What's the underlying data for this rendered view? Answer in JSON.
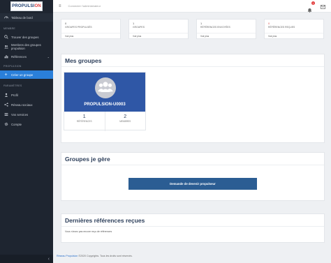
{
  "brand": {
    "logo_main": "PROPULSI",
    "logo_accent": "ON"
  },
  "topbar": {
    "title": "Connecter l'administrateur",
    "notif_count": "1"
  },
  "sidebar": {
    "dashboard": "Tableau de bord",
    "section_membre": "MEMBRE",
    "find_groups": "Trouver des groupes",
    "members_line1": "Membres des groupes",
    "members_line2": "propulsion",
    "references": "Références",
    "section_propulsion": "PROPULSION",
    "create_group": "Créer un groupe",
    "section_parametres": "PARAMÈTRES",
    "profile": "Profil",
    "social": "Réseau sociaux",
    "services": "Vos services",
    "account": "Compte"
  },
  "stats": [
    {
      "value": "0",
      "label": "GROUPES PROPULSÉS",
      "link": "Voir plus"
    },
    {
      "value": "1",
      "label": "GROUPES",
      "link": "Voir plus"
    },
    {
      "value": "1",
      "label": "RÉFÉRENCES ENVOYÉES",
      "link": "Voir plus"
    },
    {
      "value": "0",
      "label": "RÉFÉRENCES REÇUES",
      "link": "Voir plus"
    }
  ],
  "mes_groupes": {
    "title": "Mes groupes",
    "group": {
      "name": "PROPULSION-U0003",
      "referrals": "1",
      "referrals_label": "RÉFÉRENCES",
      "members": "2",
      "members_label": "MEMBRES"
    }
  },
  "groupes_gere": {
    "title": "Groupes je gère",
    "button": "Demande de devenir propulseur"
  },
  "dernieres": {
    "title": "Dernières références reçues",
    "empty": "Vous n'avez pas encore reçu de références"
  },
  "footer": {
    "link": "Réseau Propulsion",
    "text": " ©2020 Copyrights. Tous les droits sont réservés."
  }
}
